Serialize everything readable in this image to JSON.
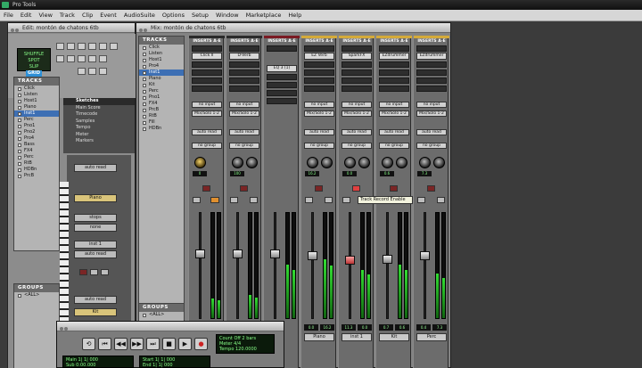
{
  "app": {
    "title": "Pro Tools"
  },
  "menu": [
    "File",
    "Edit",
    "View",
    "Track",
    "Clip",
    "Event",
    "AudioSuite",
    "Options",
    "Setup",
    "Window",
    "Marketplace",
    "Help"
  ],
  "edit_window": {
    "title": "Edit: montón de chatons 6tb",
    "tracks_header": "TRACKS",
    "groups_header": "GROUPS",
    "lcd_line1": "SHUFFLE  SPOT",
    "lcd_line2": "SLIP",
    "lcd_grid": "GRID",
    "tracks": [
      "Click",
      "Listen",
      "Host1",
      "Piano",
      "Inst1",
      "Perc",
      "Pno1",
      "Pno2",
      "Pro4",
      "Bass",
      "FX4",
      "Perc",
      "RtB",
      "HDBn",
      "PrcB"
    ],
    "memory_header": "Sketches",
    "memory_items": [
      "Main Score",
      "Timecode",
      "Samples",
      "Tempo",
      "Meter",
      "Markers"
    ],
    "strip_labels": [
      "auto read",
      "Piano",
      "stops",
      "none",
      "inst 1",
      "auto read",
      "auto read",
      "Kit"
    ],
    "groups": [
      "<ALL>"
    ]
  },
  "mix_window": {
    "title": "Mix: montón de chatons 6tb",
    "tracks_header": "TRACKS",
    "groups_header": "GROUPS",
    "tracks": [
      "Click",
      "Listen",
      "Host1",
      "Pro4",
      "Inst1",
      "Piano",
      "Kit",
      "Perc",
      "Pno1",
      "FX4",
      "PrcB",
      "RtB",
      "Fill",
      "HDBn"
    ],
    "groups": [
      "<ALL>"
    ],
    "strips": [
      {
        "name": "Click",
        "insert": "INSERTS A-E",
        "plugin": "Click II",
        "io_in": "no input",
        "io_out": "Mix/Solo 1-2",
        "auto": "auto read",
        "group": "no group",
        "vol": "0.0",
        "pan": "0",
        "color": "#2a2a2a",
        "level": 0.18,
        "fader": 0.62,
        "rec": false
      },
      {
        "name": "",
        "insert": "INSERTS A-E",
        "plugin": "D-Verb",
        "io_in": "no input",
        "io_out": "Mix/Solo 1-2",
        "auto": "auto read",
        "group": "no group",
        "vol": "0.0",
        "pan": "100",
        "color": "#2a2a2a",
        "level": 0.22,
        "fader": 0.62,
        "rec": false
      },
      {
        "name": "",
        "insert": "INSERTS A-E",
        "plugin": "EQ 3 (1)",
        "io_in": "",
        "io_out": "",
        "auto": "",
        "group": "",
        "vol": "",
        "pan": "",
        "color": "#7a1a22",
        "level": 0.5,
        "fader": 0.0,
        "rec": false
      },
      {
        "name": "Piano",
        "insert": "INSERTS A-E",
        "plugin": "EZ Verb",
        "io_in": "no input",
        "io_out": "Mix/Solo 1-2",
        "auto": "auto read",
        "group": "no group",
        "vol": "0.0",
        "pan": "16.2",
        "color": "#d4aa3a",
        "level": 0.55,
        "fader": 0.6,
        "rec": false
      },
      {
        "name": "inst 1",
        "insert": "INSERTS A-E",
        "plugin": "SparkFX",
        "io_in": "no input",
        "io_out": "Mix/Solo 1-2",
        "auto": "auto read",
        "group": "no group",
        "vol": "11.3",
        "pan": "0.0",
        "color": "#d4aa3a",
        "level": 0.45,
        "fader": 0.55,
        "rec": true
      },
      {
        "name": "Kit",
        "insert": "INSERTS A-E",
        "plugin": "EZdrummer",
        "io_in": "no input",
        "io_out": "Mix/Solo 1-2",
        "auto": "auto read",
        "group": "no group",
        "vol": "0.7",
        "pan": "0.6",
        "color": "#d4aa3a",
        "level": 0.5,
        "fader": 0.56,
        "rec": false
      },
      {
        "name": "Perc",
        "insert": "INSERTS A-E",
        "plugin": "EZdrummer",
        "io_in": "no input",
        "io_out": "Mix/Solo 1-2",
        "auto": "auto read",
        "group": "no group",
        "vol": "0.4",
        "pan": "7.3",
        "color": "#d4aa3a",
        "level": 0.42,
        "fader": 0.6,
        "rec": false
      }
    ],
    "tooltip": "Track Record Enable"
  },
  "transport": {
    "counter_label": "Count Off",
    "counter_value": "2 bars",
    "meter_label": "Meter",
    "meter_value": "4/4",
    "tempo_label": "Tempo",
    "tempo_value": "120.0000",
    "main_label": "Main",
    "main_value": "1| 1| 000",
    "sub_label": "Sub",
    "sub_value": "0:00.000",
    "start_label": "Start",
    "start_value": "1| 1| 000",
    "end_label": "End",
    "end_value": "1| 1| 000"
  }
}
